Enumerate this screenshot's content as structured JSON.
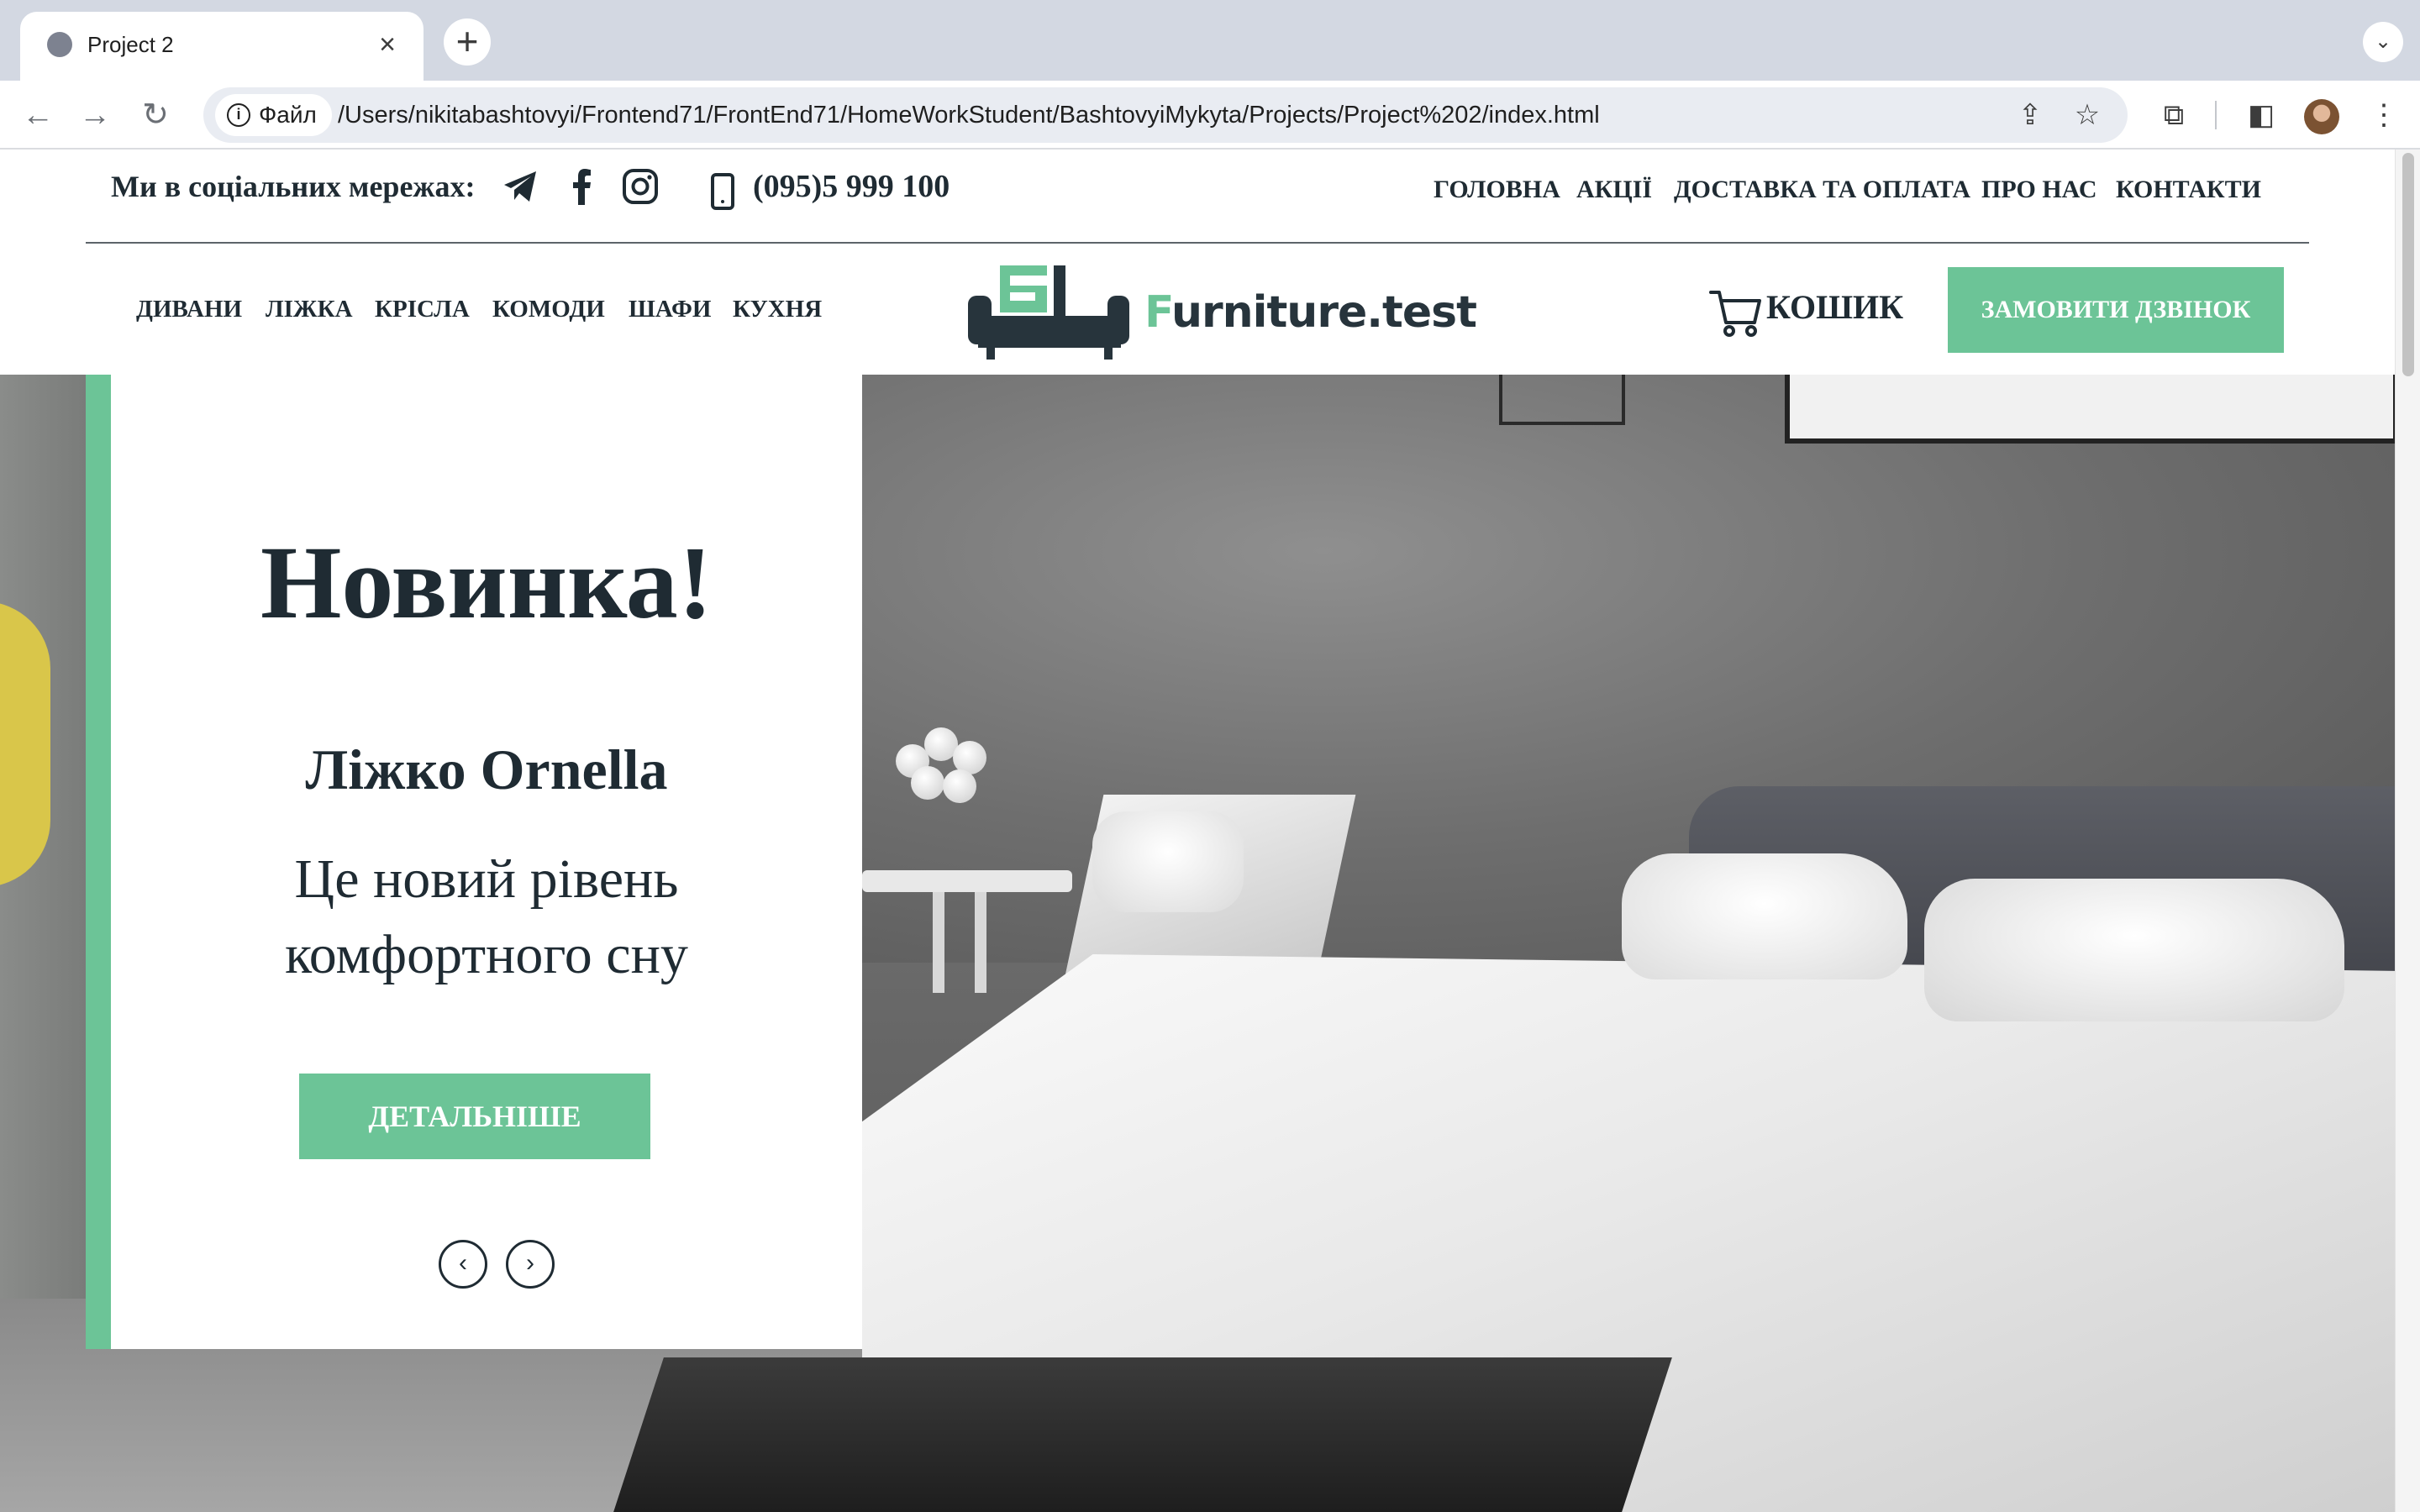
{
  "browser": {
    "tab_title": "Project 2",
    "tab_close": "×",
    "new_tab": "+",
    "tab_menu": "⌄",
    "site_chip": "Файл",
    "url": "/Users/nikitabashtovyi/Frontend71/FrontEnd71/HomeWorkStudent/BashtovyiMykyta/Projects/Project%202/index.html"
  },
  "header": {
    "social_label": "Ми в соціальних мережах:",
    "phone": "(095)5 999 100",
    "top_nav": [
      "ГОЛОВНА",
      "АКЦІЇ",
      "ДОСТАВКА ТА ОПЛАТА",
      "ПРО НАС",
      "КОНТАКТИ"
    ],
    "categories": [
      "ДИВАНИ",
      "ЛІЖКА",
      "КРІСЛА",
      "КОМОДИ",
      "ШАФИ",
      "КУХНЯ"
    ],
    "logo_first_letter": "F",
    "logo_rest": "urniture.test",
    "cart_label": "КОШИК",
    "call_button": "ЗАМОВИТИ ДЗВІНОК"
  },
  "hero": {
    "title": "Новинка!",
    "product": "Ліжко Ornella",
    "description": "Це новий рівень комфортного сну",
    "button": "ДЕТАЛЬНІШЕ",
    "prev": "‹",
    "next": "›"
  },
  "colors": {
    "accent": "#6cc497",
    "text_dark": "#1f2b33"
  }
}
